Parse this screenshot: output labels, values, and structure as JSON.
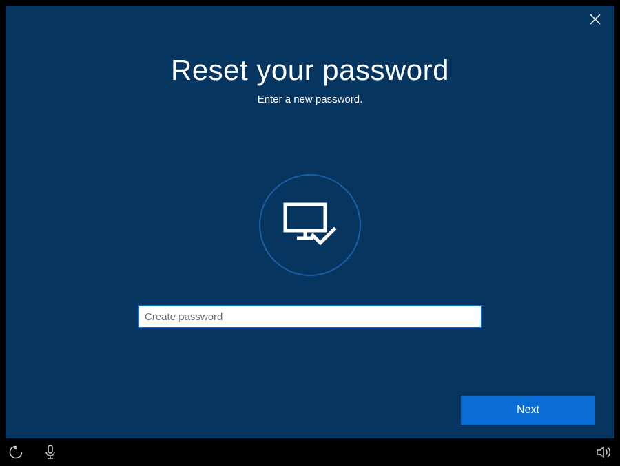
{
  "header": {
    "title": "Reset your password",
    "subtitle": "Enter a new password."
  },
  "form": {
    "password_placeholder": "Create password",
    "password_value": ""
  },
  "actions": {
    "next_label": "Next"
  },
  "icons": {
    "close": "close-icon",
    "monitor": "monitor-check-icon",
    "ease_of_access": "ease-of-access-icon",
    "microphone": "microphone-icon",
    "volume": "volume-icon"
  },
  "colors": {
    "background": "#063560",
    "accent": "#0a6dd6",
    "circle_border": "#1861a8"
  }
}
